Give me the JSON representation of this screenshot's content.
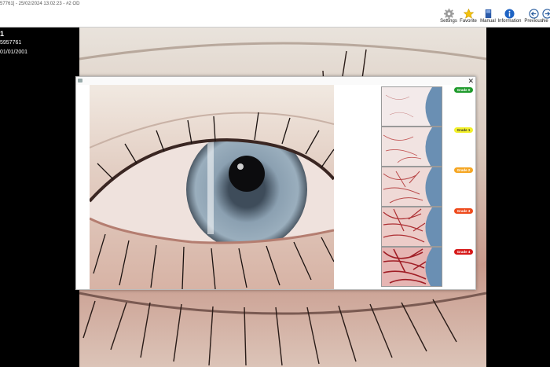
{
  "window": {
    "title": "57761] - 25/02/2024 13:02:23 - #2 OD"
  },
  "toolbar": {
    "buttons": [
      {
        "label": "Settings",
        "icon": "gear-icon"
      },
      {
        "label": "Favorite",
        "icon": "star-icon"
      },
      {
        "label": "Manual",
        "icon": "book-icon"
      },
      {
        "label": "Information",
        "icon": "info-icon"
      },
      {
        "label": "Previous",
        "icon": "arrow-left-icon"
      },
      {
        "label": "Ne",
        "icon": "arrow-right-icon"
      }
    ]
  },
  "patient": {
    "number": "1",
    "id": "5957761",
    "dob": "01/01/2001"
  },
  "grading": {
    "grades": [
      {
        "label": "Grade 0",
        "color": "#1f9a2c"
      },
      {
        "label": "Grade 1",
        "color": "#f2f02a"
      },
      {
        "label": "Grade 2",
        "color": "#f5a623"
      },
      {
        "label": "Grade 3",
        "color": "#ee4a1c"
      },
      {
        "label": "Grade 4",
        "color": "#d61818"
      }
    ]
  },
  "colors": {
    "background": "#000000",
    "toolbar": "#ffffff",
    "sclera": "#f0e4e0",
    "iris": "#7e95a8"
  }
}
